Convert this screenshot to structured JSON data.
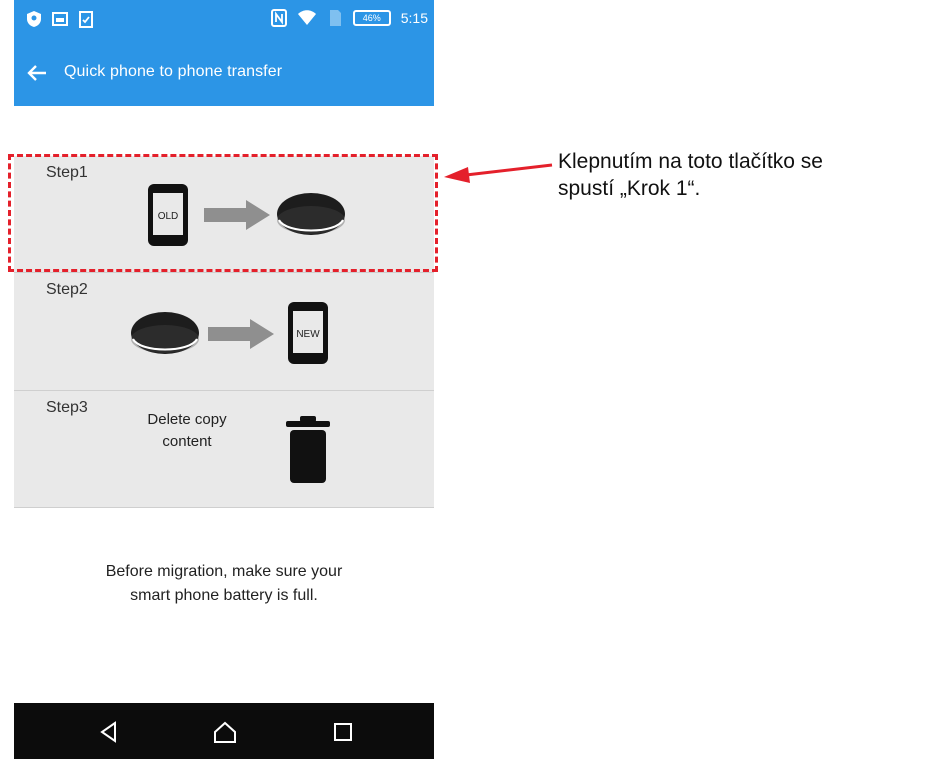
{
  "status_bar": {
    "time": "5:15",
    "battery_percent": "46%",
    "icons": [
      "shield-icon",
      "image-icon",
      "clipboard-icon",
      "nfc-icon",
      "wifi-icon",
      "sim-icon",
      "battery-icon"
    ]
  },
  "app_bar": {
    "title": "Quick phone to phone transfer",
    "back_icon": "back-arrow-icon"
  },
  "steps": [
    {
      "label": "Step1",
      "from_icon_text": "OLD",
      "icons": [
        "old-phone-icon",
        "arrow-right-icon",
        "storage-puck-icon"
      ]
    },
    {
      "label": "Step2",
      "to_icon_text": "NEW",
      "icons": [
        "storage-puck-icon",
        "arrow-right-icon",
        "new-phone-icon"
      ]
    },
    {
      "label": "Step3",
      "text_line1": "Delete copy",
      "text_line2": "content",
      "icons": [
        "trash-icon"
      ]
    }
  ],
  "info": {
    "line1": "Before migration, make sure your",
    "line2": "smart phone battery is full."
  },
  "nav_bar": {
    "buttons": [
      "back-triangle-icon",
      "home-icon",
      "recents-icon"
    ]
  },
  "annotation": {
    "line1": "Klepnutím na toto tlačítko se",
    "line2": "spustí „Krok 1“."
  },
  "colors": {
    "primary": "#2c95e6",
    "step_bg": "#e9e9e9",
    "highlight": "#e4202b",
    "nav_bg": "#0c0c0c"
  }
}
